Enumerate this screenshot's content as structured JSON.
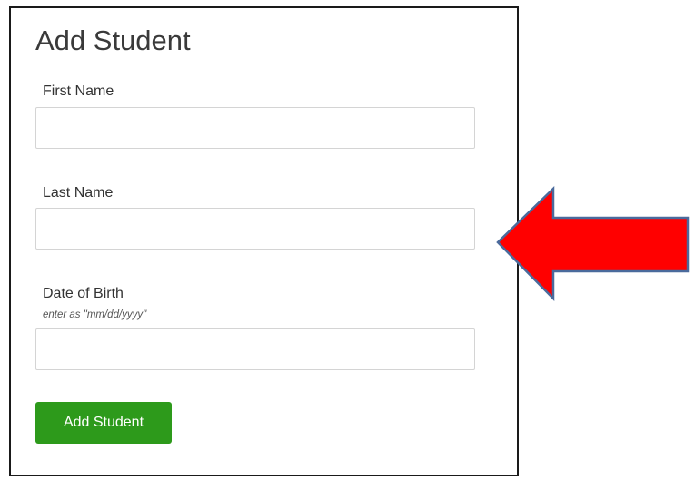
{
  "form": {
    "title": "Add Student",
    "fields": [
      {
        "label": "First Name",
        "value": "",
        "placeholder": ""
      },
      {
        "label": "Last Name",
        "value": "",
        "placeholder": ""
      },
      {
        "label": "Date of Birth",
        "hint": "enter as \"mm/dd/yyyy\"",
        "value": "",
        "placeholder": ""
      }
    ],
    "submit_label": "Add Student"
  },
  "annotation": {
    "arrow_fill": "#ff0000",
    "arrow_stroke": "#4a6a9c",
    "direction": "left"
  },
  "colors": {
    "button": "#2d9a1b",
    "button_text": "#ffffff",
    "panel_border": "#1a1a1a",
    "input_border": "#d4d4d4"
  }
}
